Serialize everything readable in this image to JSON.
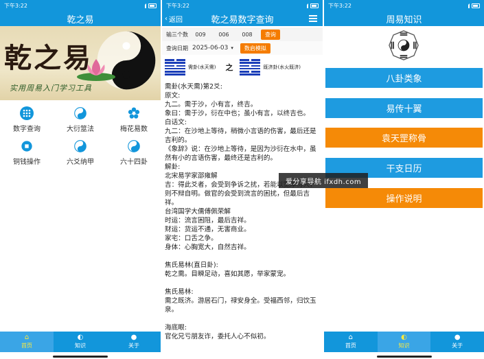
{
  "status": {
    "time": "下午3:22"
  },
  "panel1": {
    "title": "乾之易",
    "banner_title": "乾之易",
    "banner_subtitle": "实用周易入门学习工具",
    "grid": [
      {
        "label": "数字查询",
        "icon": "grid-dots-icon"
      },
      {
        "label": "大衍筮法",
        "icon": "yinyang-icon"
      },
      {
        "label": "梅花易数",
        "icon": "plum-blossom-icon"
      },
      {
        "label": "铜钱操作",
        "icon": "coin-icon"
      },
      {
        "label": "六爻纳甲",
        "icon": "yinyang-icon"
      },
      {
        "label": "六十四卦",
        "icon": "yinyang-icon"
      }
    ]
  },
  "panel2": {
    "title": "乾之易数字查询",
    "back_label": "返回",
    "query": {
      "numbers_label": "输三个数",
      "n1": "009",
      "n2": "006",
      "n3": "008",
      "query_button": "查询",
      "date_label": "查询日期",
      "date_value": "2025-06-03",
      "random_button": "数启模拟"
    },
    "hexagrams": {
      "from_name": "需卦(水天需)",
      "connector": "之",
      "to_name": "既济卦(水火既济)"
    },
    "text_lines": [
      "需卦(水天需)第2爻:",
      "原文:",
      "九二。需于沙，小有言，终吉。",
      "象曰：需于沙，衍在中也；虽小有言，以终吉也。",
      "白话文:",
      "九二：在沙地上等待，稍微小言语的伤害，最后还是吉利的。",
      "《象辞》说：在沙地上等待，是因为沙衍在水中，虽然有小的言语伤害，最终还是吉利的。",
      "解卦:",
      "北宋易学家邵雍解",
      "吉：得此爻者，会受到争诉之扰，若能以宽厚待人，则不辩自明。做官的会受到流言的困扰，但最后吉祥。",
      "台湾国学大儒傅佩荣解",
      "时运：流言困阻，最后吉祥。",
      "财运：货运不通，无害商业。",
      "家宅：口舌之争。",
      "身体：心胸宽大，自然吉祥。",
      "",
      "焦氏易林(直日卦):",
      "乾之需。目瞬足动，喜如其愿，举家蒙宠。",
      "",
      "焦氏易林:",
      "需之既济。游居石门，禄安身全。受福西邻，归饮玉泉。",
      "",
      "海底眼:",
      "官化兄亏朋友诈，委托人心不似初。"
    ]
  },
  "panel3": {
    "title": "周易知识",
    "buttons": [
      {
        "label": "八卦类象",
        "color": "#1e9be0"
      },
      {
        "label": "易传十翼",
        "color": "#1e9be0"
      },
      {
        "label": "袁天罡称骨",
        "color": "#f58a07"
      },
      {
        "label": "干支日历",
        "color": "#1e9be0"
      },
      {
        "label": "操作说明",
        "color": "#f58a07"
      }
    ]
  },
  "tabs": [
    {
      "label": "首页",
      "icon": "home-icon"
    },
    {
      "label": "知识",
      "icon": "yinyang-icon"
    },
    {
      "label": "关于",
      "icon": "user-icon"
    }
  ],
  "watermark": "爱分享导航 ifxdh.com",
  "colors": {
    "primary": "#1296db",
    "orange": "#f58a07",
    "tab_active": "#ffeb3b",
    "hexagram_blue": "#1a3db8"
  }
}
